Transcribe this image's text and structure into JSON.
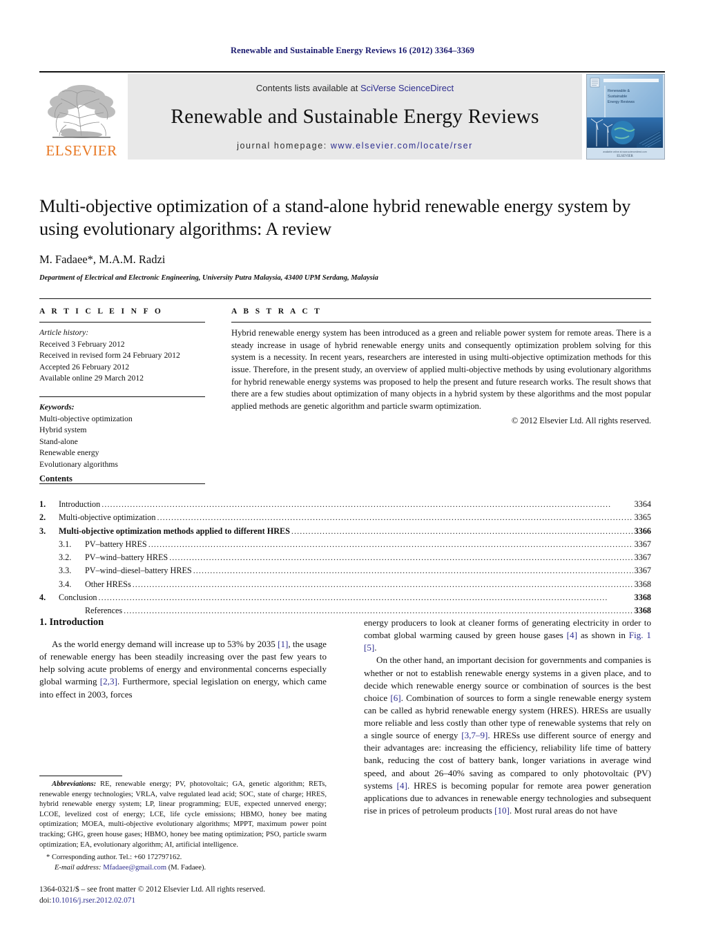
{
  "running_head": "Renewable and Sustainable Energy Reviews 16 (2012) 3364–3369",
  "masthead": {
    "publisher_logo_text": "ELSEVIER",
    "contents_prefix": "Contents lists available at ",
    "contents_link": "SciVerse ScienceDirect",
    "journal_title": "Renewable and Sustainable Energy Reviews",
    "homepage_prefix": "journal homepage: ",
    "homepage_url": "www.elsevier.com/locate/rser",
    "cover_title_lines": [
      "Renewable &",
      "Sustainable",
      "Energy Reviews"
    ],
    "cover_publisher": "ELSEVIER",
    "link_color": "#2d2d8f",
    "logo_color": "#E87722",
    "panel_bg": "#e8e8e8"
  },
  "article": {
    "title": "Multi-objective optimization of a stand-alone hybrid renewable energy system by using evolutionary algorithms: A review",
    "authors": "M. Fadaee*, M.A.M. Radzi",
    "affiliation": "Department of Electrical and Electronic Engineering, University Putra Malaysia, 43400 UPM Serdang, Malaysia"
  },
  "article_info": {
    "heading": "A R T I C L E     I N F O",
    "history_label": "Article history:",
    "history": [
      "Received 3 February 2012",
      "Received in revised form 24 February 2012",
      "Accepted 26 February 2012",
      "Available online 29 March 2012"
    ],
    "keywords_label": "Keywords:",
    "keywords": [
      "Multi-objective optimization",
      "Hybrid system",
      "Stand-alone",
      "Renewable energy",
      "Evolutionary algorithms"
    ]
  },
  "abstract": {
    "heading": "A B S T R A C T",
    "text": "Hybrid renewable energy system has been introduced as a green and reliable power system for remote areas. There is a steady increase in usage of hybrid renewable energy units and consequently optimization problem solving for this system is a necessity. In recent years, researchers are interested in using multi-objective optimization methods for this issue. Therefore, in the present study, an overview of applied multi-objective methods by using evolutionary algorithms for hybrid renewable energy systems was proposed to help the present and future research works. The result shows that there are a few studies about optimization of many objects in a hybrid system by these algorithms and the most popular applied methods are genetic algorithm and particle swarm optimization.",
    "copyright": "© 2012 Elsevier Ltd. All rights reserved."
  },
  "contents": {
    "heading": "Contents",
    "entries": [
      {
        "num": "1.",
        "label": "Introduction",
        "page": "3364",
        "level": 1
      },
      {
        "num": "2.",
        "label": "Multi-objective optimization",
        "page": "3365",
        "level": 1
      },
      {
        "num": "3.",
        "label": "Multi-objective optimization methods applied to different HRES",
        "page": "3366",
        "level": 1
      },
      {
        "num": "3.1.",
        "label": "PV–battery HRES",
        "page": "3367",
        "level": 2
      },
      {
        "num": "3.2.",
        "label": "PV–wind–battery HRES",
        "page": "3367",
        "level": 2
      },
      {
        "num": "3.3.",
        "label": "PV–wind–diesel–battery HRES",
        "page": "3367",
        "level": 2
      },
      {
        "num": "3.4.",
        "label": "Other HRESs",
        "page": "3368",
        "level": 2
      },
      {
        "num": "4.",
        "label": "Conclusion",
        "page": "3368",
        "level": 1
      },
      {
        "num": "",
        "label": "References",
        "page": "3368",
        "level": 2
      }
    ]
  },
  "body": {
    "section_heading": "1.  Introduction",
    "left_p1_a": "As the world energy demand will increase up to 53% by 2035 ",
    "left_p1_r1": "[1]",
    "left_p1_b": ", the usage of renewable energy has been steadily increasing over the past few years to help solving acute problems of energy and environmental concerns especially global warming ",
    "left_p1_r2": "[2,3]",
    "left_p1_c": ". Furthermore, special legislation on energy, which came into effect in 2003, forces",
    "right_p1_a": "energy producers to look at cleaner forms of generating electricity in order to combat global warming caused by green house gases ",
    "right_p1_r1": "[4]",
    "right_p1_b": " as shown in ",
    "right_p1_r2": "Fig. 1 [5]",
    "right_p1_c": ".",
    "right_p2_a": "On the other hand, an important decision for governments and companies is whether or not to establish renewable energy systems in a given place, and to decide which renewable energy source or combination of sources is the best choice ",
    "right_p2_r1": "[6]",
    "right_p2_b": ". Combination of sources to form a single renewable energy system can be called as hybrid renewable energy system (HRES). HRESs are usually more reliable and less costly than other type of renewable systems that rely on a single source of energy ",
    "right_p2_r2": "[3,7–9]",
    "right_p2_c": ". HRESs use different source of energy and their advantages are: increasing the efficiency, reliability life time of battery bank, reducing the cost of battery bank, longer variations in average wind speed, and about 26–40% saving as compared to only photovoltaic (PV) systems ",
    "right_p2_r3": "[4]",
    "right_p2_d": ". HRES is becoming popular for remote area power generation applications due to advances in renewable energy technologies and subsequent rise in prices of petroleum products ",
    "right_p2_r4": "[10]",
    "right_p2_e": ". Most rural areas do not have"
  },
  "footnote": {
    "abbrev_label": "Abbreviations:",
    "abbrev_text": " RE, renewable energy; PV, photovoltaic; GA, genetic algorithm; RETs, renewable energy technologies; VRLA, valve regulated lead acid; SOC, state of charge; HRES, hybrid renewable energy system; LP, linear programming; EUE, expected unnerved energy; LCOE, levelized cost of energy; LCE, life cycle emissions; HBMO, honey bee mating optimization; MOEA, multi-objective evolutionary algorithms; MPPT, maximum power point tracking; GHG, green house gases; HBMO, honey bee mating optimization; PSO, particle swarm optimization; EA, evolutionary algorithm; AI, artificial intelligence.",
    "corresponding": "* Corresponding author. Tel.: +60 172797162.",
    "email_label": "E-mail address:",
    "email": "Mfadaee@gmail.com",
    "email_suffix": " (M. Fadaee).",
    "front_matter": "1364-0321/$ – see front matter © 2012 Elsevier Ltd. All rights reserved.",
    "doi_label": "doi:",
    "doi": "10.1016/j.rser.2012.02.071"
  }
}
